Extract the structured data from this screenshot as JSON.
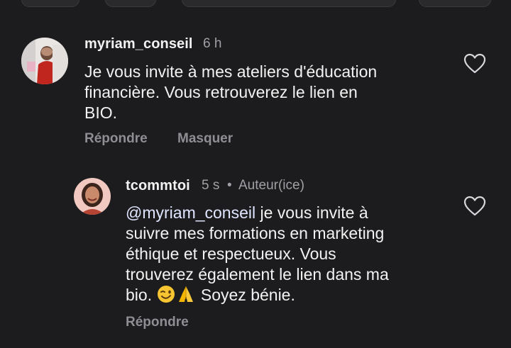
{
  "comments": [
    {
      "username": "myriam_conseil",
      "time": "6 h",
      "text": "Je vous invite à mes ateliers d'éducation financière. Vous retrouverez le lien en BIO.",
      "text_lines": [
        "Je vous invite à mes ateliers d'éducation",
        "financière. Vous retrouverez le lien en",
        "BIO."
      ],
      "actions": {
        "reply": "Répondre",
        "hide": "Masquer"
      },
      "like_icon": "heart-outline-icon"
    }
  ],
  "reply": {
    "username": "tcommtoi",
    "time": "5 s",
    "separator": "•",
    "author_badge": "Auteur(ice)",
    "mention": "@myriam_conseil",
    "text_lines": [
      " je vous invite à",
      "suivre mes formations en marketing",
      "éthique et respectueux. Vous",
      "trouverez également le lien dans ma",
      "bio. "
    ],
    "emojis": [
      "wink-face-emoji",
      "folded-hands-emoji"
    ],
    "text_tail": " Soyez bénie.",
    "actions": {
      "reply": "Répondre"
    },
    "like_icon": "heart-outline-icon"
  },
  "colors": {
    "background": "#1c1c1e",
    "text": "#f2f2f2",
    "muted": "#a0a0a5",
    "action": "#8e8e93"
  }
}
